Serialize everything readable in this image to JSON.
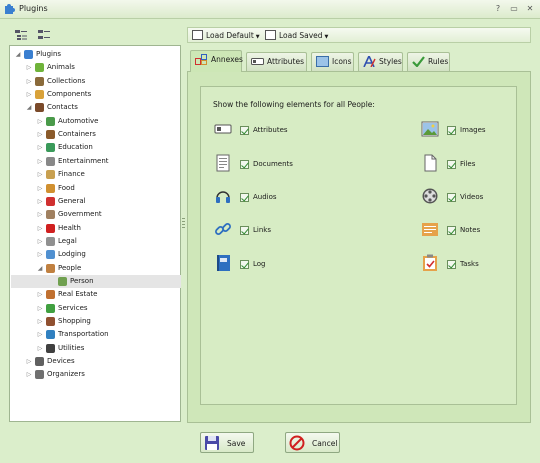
{
  "window": {
    "title": "Plugins",
    "controls": [
      "?",
      "▭",
      "✕"
    ]
  },
  "tree": [
    {
      "label": "Plugins",
      "level": 0,
      "arrow": "◢",
      "icon": "puzzle-icon",
      "color": "#3a7fd0"
    },
    {
      "label": "Animals",
      "level": 1,
      "arrow": "▷",
      "icon": "animals-icon",
      "color": "#6fb33a"
    },
    {
      "label": "Collections",
      "level": 1,
      "arrow": "▷",
      "icon": "collections-icon",
      "color": "#8a6a3a"
    },
    {
      "label": "Components",
      "level": 1,
      "arrow": "▷",
      "icon": "components-icon",
      "color": "#d9a23a"
    },
    {
      "label": "Contacts",
      "level": 1,
      "arrow": "◢",
      "icon": "contacts-icon",
      "color": "#7a4a2a"
    },
    {
      "label": "Automotive",
      "level": 2,
      "arrow": "▷",
      "icon": "car-icon",
      "color": "#4a9a4a"
    },
    {
      "label": "Containers",
      "level": 2,
      "arrow": "▷",
      "icon": "containers-icon",
      "color": "#8a5a2a"
    },
    {
      "label": "Education",
      "level": 2,
      "arrow": "▷",
      "icon": "education-icon",
      "color": "#3a9a5a"
    },
    {
      "label": "Entertainment",
      "level": 2,
      "arrow": "▷",
      "icon": "entertainment-icon",
      "color": "#888888"
    },
    {
      "label": "Finance",
      "level": 2,
      "arrow": "▷",
      "icon": "finance-icon",
      "color": "#c8a050"
    },
    {
      "label": "Food",
      "level": 2,
      "arrow": "▷",
      "icon": "food-icon",
      "color": "#d09030"
    },
    {
      "label": "General",
      "level": 2,
      "arrow": "▷",
      "icon": "general-icon",
      "color": "#d03030"
    },
    {
      "label": "Government",
      "level": 2,
      "arrow": "▷",
      "icon": "government-icon",
      "color": "#a08060"
    },
    {
      "label": "Health",
      "level": 2,
      "arrow": "▷",
      "icon": "health-icon",
      "color": "#d02020"
    },
    {
      "label": "Legal",
      "level": 2,
      "arrow": "▷",
      "icon": "legal-icon",
      "color": "#909090"
    },
    {
      "label": "Lodging",
      "level": 2,
      "arrow": "▷",
      "icon": "lodging-icon",
      "color": "#5090d0"
    },
    {
      "label": "People",
      "level": 2,
      "arrow": "◢",
      "icon": "people-icon",
      "color": "#c08040"
    },
    {
      "label": "Person",
      "level": 3,
      "arrow": "",
      "icon": "person-icon",
      "color": "#70a050",
      "selected": true
    },
    {
      "label": "Real Estate",
      "level": 2,
      "arrow": "▷",
      "icon": "real-estate-icon",
      "color": "#c07030"
    },
    {
      "label": "Services",
      "level": 2,
      "arrow": "▷",
      "icon": "services-icon",
      "color": "#40a040"
    },
    {
      "label": "Shopping",
      "level": 2,
      "arrow": "▷",
      "icon": "shopping-icon",
      "color": "#905030"
    },
    {
      "label": "Transportation",
      "level": 2,
      "arrow": "▷",
      "icon": "transportation-icon",
      "color": "#3080c0"
    },
    {
      "label": "Utilities",
      "level": 2,
      "arrow": "▷",
      "icon": "utilities-icon",
      "color": "#404040"
    },
    {
      "label": "Devices",
      "level": 1,
      "arrow": "▷",
      "icon": "devices-icon",
      "color": "#606060"
    },
    {
      "label": "Organizers",
      "level": 1,
      "arrow": "▷",
      "icon": "organizers-icon",
      "color": "#707070"
    }
  ],
  "toolbar": {
    "load_default": "Load Default",
    "load_saved": "Load Saved"
  },
  "tabs": [
    {
      "label": "Annexes",
      "active": true,
      "icon": "annexes-icon"
    },
    {
      "label": "Attributes",
      "active": false,
      "icon": "attributes-icon"
    },
    {
      "label": "Icons",
      "active": false,
      "icon": "icons-icon"
    },
    {
      "label": "Styles",
      "active": false,
      "icon": "styles-icon"
    },
    {
      "label": "Rules",
      "active": false,
      "icon": "rules-icon"
    }
  ],
  "panel": {
    "heading": "Show the following elements for all People:",
    "elements": [
      {
        "label": "Attributes",
        "checked": true,
        "icon": "attributes-element-icon"
      },
      {
        "label": "Documents",
        "checked": true,
        "icon": "documents-icon"
      },
      {
        "label": "Audios",
        "checked": true,
        "icon": "headphones-icon"
      },
      {
        "label": "Links",
        "checked": true,
        "icon": "link-icon"
      },
      {
        "label": "Log",
        "checked": true,
        "icon": "log-book-icon"
      },
      {
        "label": "Images",
        "checked": true,
        "icon": "image-icon"
      },
      {
        "label": "Files",
        "checked": true,
        "icon": "file-icon"
      },
      {
        "label": "Videos",
        "checked": true,
        "icon": "film-reel-icon"
      },
      {
        "label": "Notes",
        "checked": true,
        "icon": "notes-icon"
      },
      {
        "label": "Tasks",
        "checked": true,
        "icon": "tasks-clipboard-icon"
      }
    ]
  },
  "buttons": {
    "save": "Save",
    "cancel": "Cancel"
  }
}
